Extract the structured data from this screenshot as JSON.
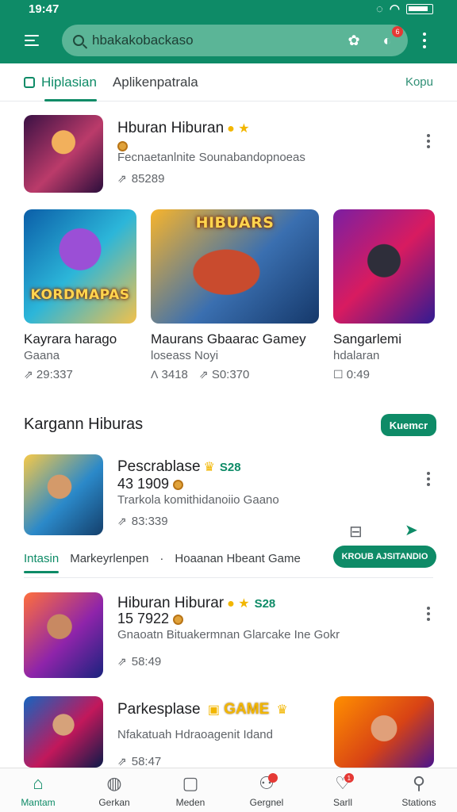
{
  "status": {
    "time": "19:47"
  },
  "appbar": {
    "search_value": "hbakakobackaso",
    "notification_count": "6"
  },
  "tabs": {
    "items": [
      {
        "label": "Hiplasian",
        "active": true
      },
      {
        "label": "Aplikenpatrala",
        "active": false
      }
    ],
    "link": "Kopu"
  },
  "feature": {
    "title": "Hburan Hiburan",
    "subtitle": "Fecnaetanlnite  Sounabandopnoeas",
    "meta": "85289"
  },
  "cards": [
    {
      "title": "Kayrara harago",
      "sub": "Gaana",
      "meta1": "",
      "meta2": "29:337",
      "art_word": "KORDMAPAS"
    },
    {
      "title": "Maurans Gbaarac Gamey",
      "sub": "loseass    Noyi",
      "meta1": "3418",
      "meta2": "S0:370",
      "art_word": "HIBUARS"
    },
    {
      "title": "Sangarlemi",
      "sub": "hdalaran",
      "meta1": "",
      "meta2": "0:49",
      "art_word": ""
    }
  ],
  "section": {
    "title": "Kargann Hiburas",
    "button": "Kuemcr"
  },
  "item1": {
    "title": "Pescrablase",
    "price": "S28",
    "line2": "43 1909",
    "desc": "Trarkola komithidanoiio Gaano",
    "meta": "83:339",
    "action_button": "KROUB AJSITANDIO"
  },
  "subtabs": {
    "items": [
      "Intasin",
      "Markeyrlenpen",
      "·",
      "Hoaanan Hbeant Game"
    ]
  },
  "item2": {
    "title": "Hiburan Hiburar",
    "price": "S28",
    "line2": "15 7922",
    "desc": "Gnaoatn  Bituakermnan Glarcake Ine Gokr",
    "meta": "58:49"
  },
  "item3": {
    "title": "Parkesplase",
    "game_word": "GAME",
    "desc": "Nfakatuah Hdraoagenit Idand",
    "meta": "58:47"
  },
  "bottom_nav": [
    {
      "label": "Mantam",
      "icon": "home-icon",
      "active": true
    },
    {
      "label": "Gerkan",
      "icon": "controller-icon",
      "active": false
    },
    {
      "label": "Meden",
      "icon": "tablet-icon",
      "active": false
    },
    {
      "label": "Gergnel",
      "icon": "people-icon",
      "active": false,
      "badge": ""
    },
    {
      "label": "Sarll",
      "icon": "heart-icon",
      "active": false,
      "badge": "1"
    },
    {
      "label": "Stations",
      "icon": "person-icon",
      "active": false
    }
  ],
  "colors": {
    "primary": "#0e8b67",
    "accent": "#f2b600",
    "badge": "#e53935"
  }
}
